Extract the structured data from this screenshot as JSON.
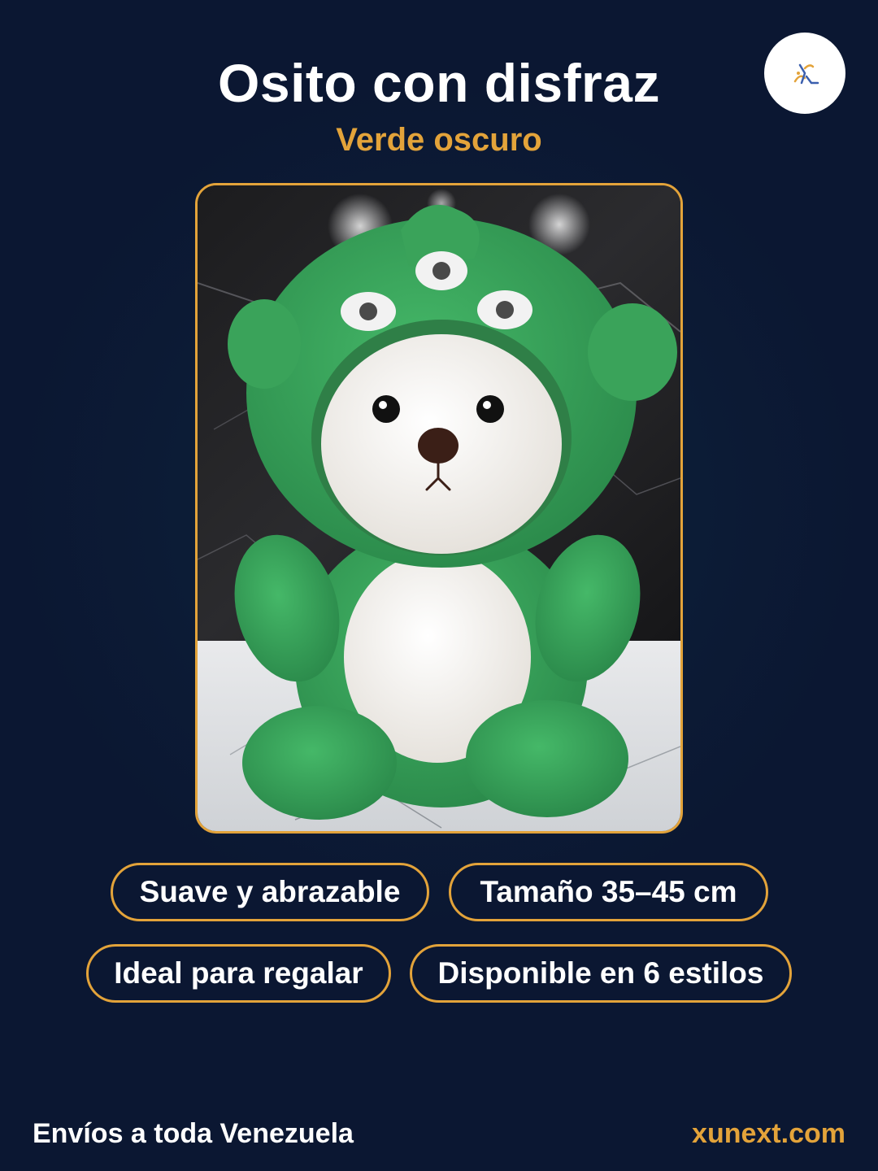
{
  "product": {
    "title": "Osito con disfraz",
    "variant": "Verde oscuro",
    "photo_subject": "green-dinosaur-costume-teddy-bear"
  },
  "features": [
    "Suave y abrazable",
    "Tamaño 35–45 cm",
    "Ideal para regalar",
    "Disponible en 6 estilos"
  ],
  "footer": {
    "shipping": "Envíos a toda Venezuela",
    "website": "xunext.com"
  },
  "colors": {
    "background": "#0b1732",
    "accent": "#e3a33a",
    "text": "#ffffff",
    "plush_green": "#34a55a"
  },
  "icons": {
    "brand_logo": "brand-logo-icon"
  }
}
